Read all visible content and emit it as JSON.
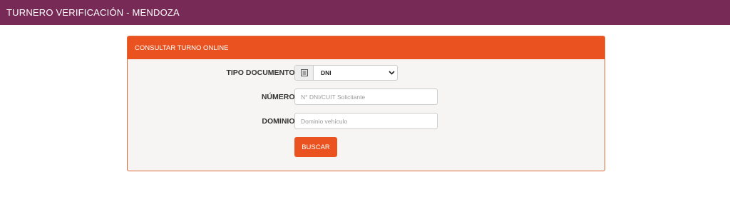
{
  "header": {
    "title": "TURNERO VERIFICACIÓN - MENDOZA"
  },
  "panel": {
    "title": "CONSULTAR TURNO ONLINE"
  },
  "form": {
    "tipo_documento_label": "TIPO DOCUMENTO:",
    "tipo_documento_value": "DNI",
    "tipo_documento_icon": "id-card-icon",
    "numero_label": "NÚMERO:",
    "numero_placeholder": "N° DNI/CUIT Solicitante",
    "dominio_label": "DOMINIO:",
    "dominio_placeholder": "Dominio vehículo",
    "buscar_label": "BUSCAR"
  },
  "colors": {
    "header_bg": "#762a55",
    "accent": "#ea5320",
    "panel_bg": "#f6f5f4"
  }
}
